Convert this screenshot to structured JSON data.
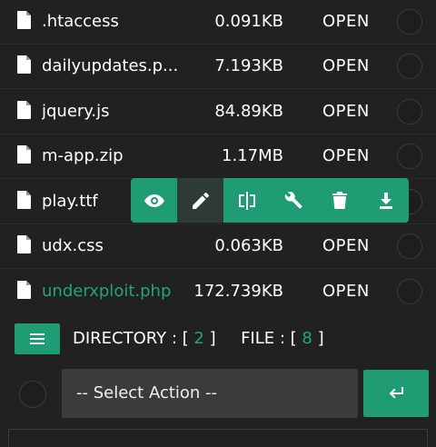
{
  "files": [
    {
      "name": ".htaccess",
      "size": "0.091KB",
      "action": "OPEN",
      "highlighted": false
    },
    {
      "name": "dailyupdates.p...",
      "size": "7.193KB",
      "action": "OPEN",
      "highlighted": false
    },
    {
      "name": "jquery.js",
      "size": "84.89KB",
      "action": "OPEN",
      "highlighted": false
    },
    {
      "name": "m-app.zip",
      "size": "1.17MB",
      "action": "OPEN",
      "highlighted": false
    },
    {
      "name": "play.ttf",
      "size": "",
      "action": "",
      "highlighted": false
    },
    {
      "name": "udx.css",
      "size": "0.063KB",
      "action": "OPEN",
      "highlighted": false
    },
    {
      "name": "underxploit.php",
      "size": "172.739KB",
      "action": "OPEN",
      "highlighted": true
    }
  ],
  "toolbar": {
    "buttons": [
      "eye-icon",
      "pencil-icon",
      "split-icon",
      "wrench-icon",
      "trash-icon",
      "download-icon"
    ],
    "active": "pencil-icon"
  },
  "summary": {
    "directory_label": "DIRECTORY :",
    "directory_count": "2",
    "file_label": "FILE :",
    "file_count": "8"
  },
  "bulk": {
    "select_text": "-- Select Action --",
    "submit_icon": "enter-icon"
  },
  "colors": {
    "accent": "#1f9c74",
    "background": "#212121",
    "highlight_text": "#1fa67a"
  }
}
